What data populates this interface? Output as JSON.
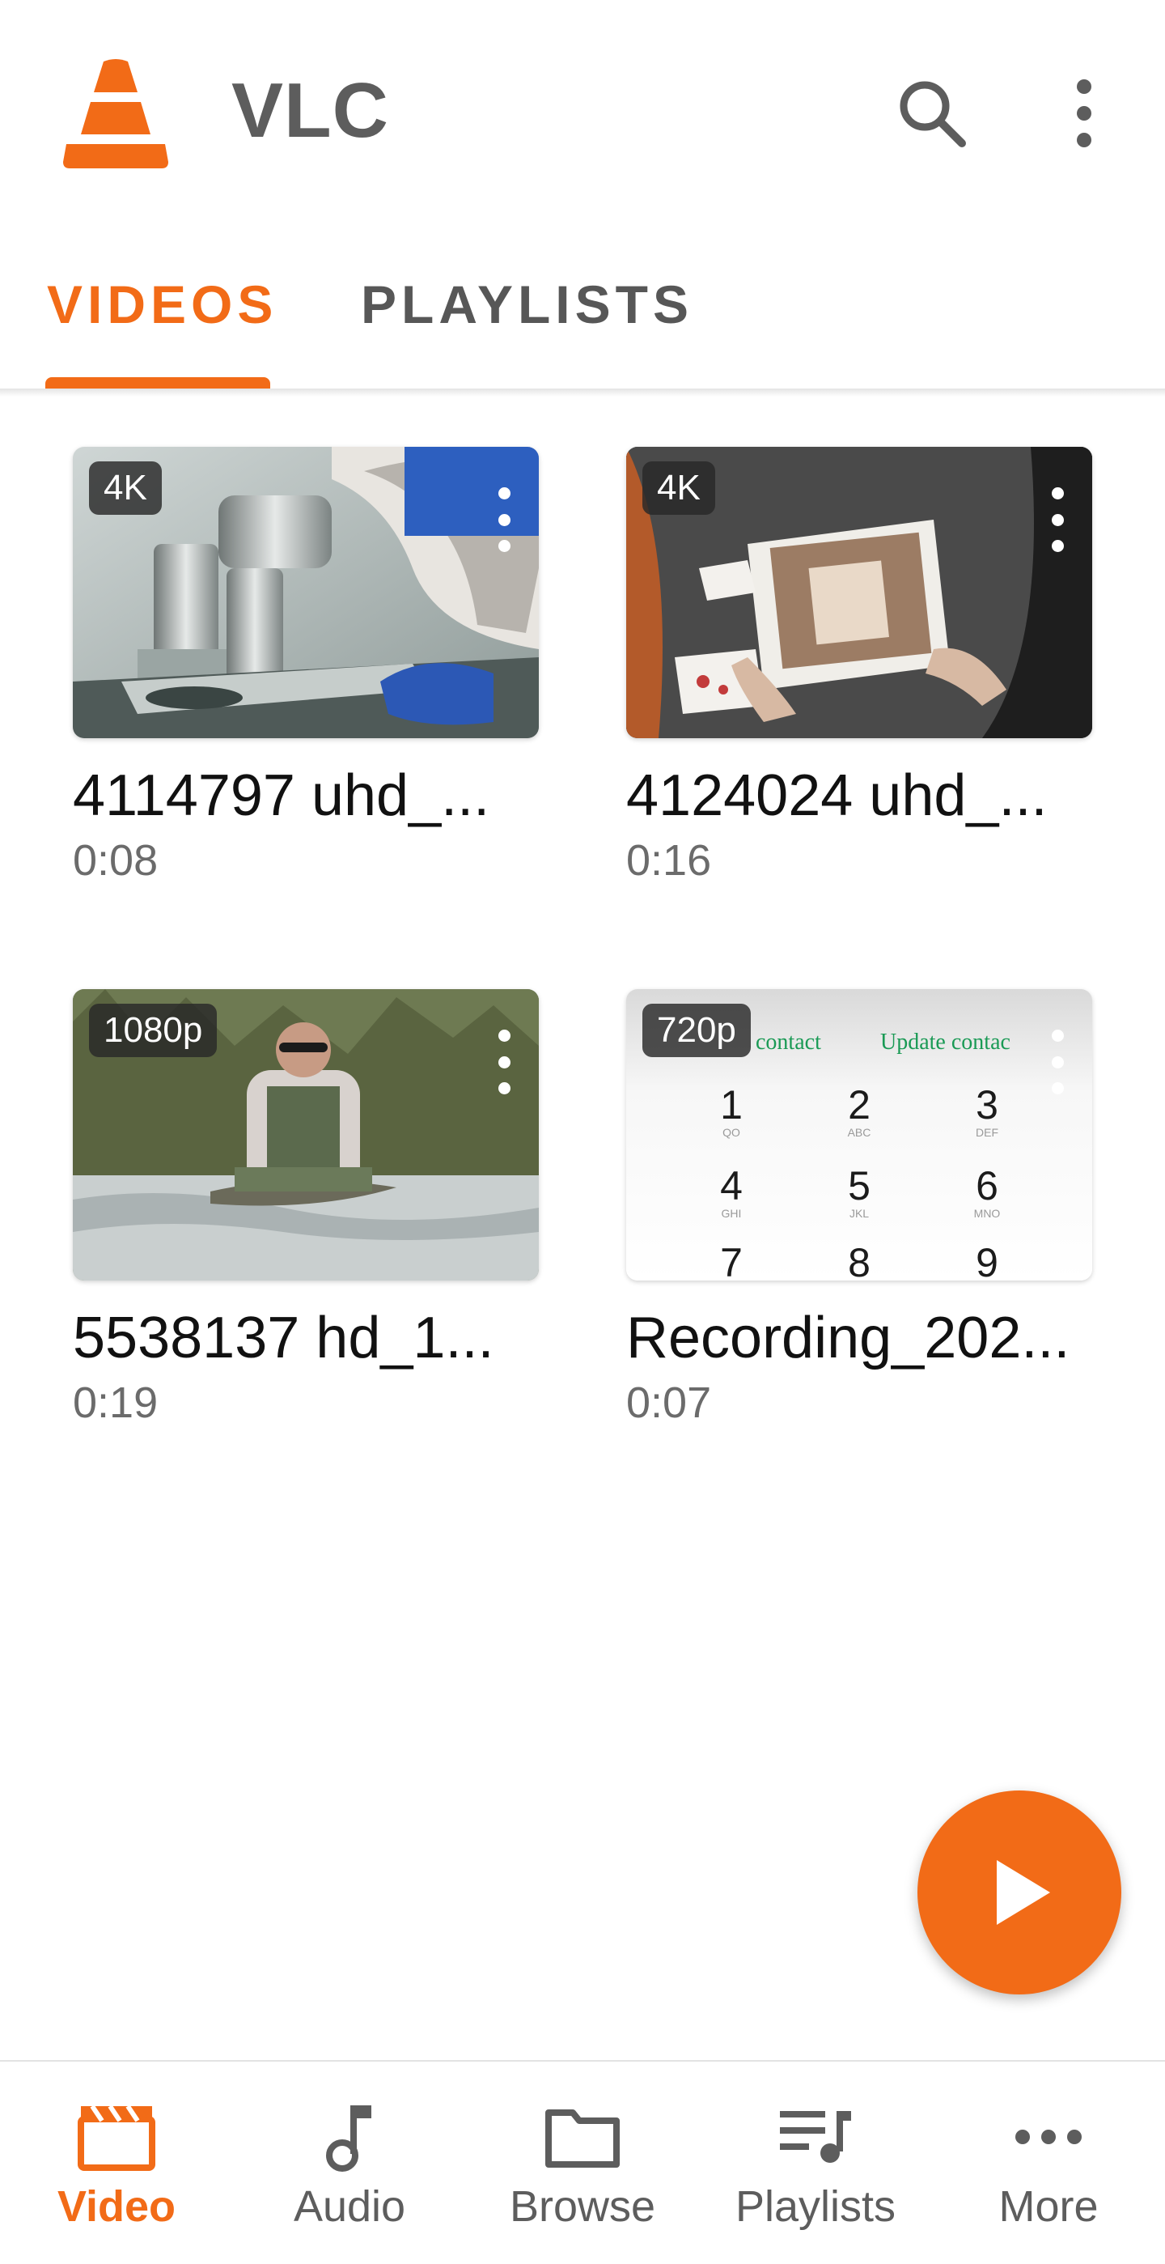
{
  "app": {
    "title": "VLC"
  },
  "tabs": [
    {
      "label": "VIDEOS",
      "active": true
    },
    {
      "label": "PLAYLISTS",
      "active": false
    }
  ],
  "videos": [
    {
      "title": "4114797 uhd_...",
      "duration": "0:08",
      "badge": "4K",
      "thumbnail": "microscope"
    },
    {
      "title": "4124024 uhd_...",
      "duration": "0:16",
      "badge": "4K",
      "thumbnail": "tablet-hands"
    },
    {
      "title": "5538137 hd_1...",
      "duration": "0:19",
      "badge": "1080p",
      "thumbnail": "fisherman-river"
    },
    {
      "title": "Recording_202...",
      "duration": "0:07",
      "badge": "720p",
      "thumbnail": "dialer-screen"
    }
  ],
  "dialer_thumb": {
    "left_text": "contact",
    "right_text": "Update contac",
    "keys": [
      "1",
      "2",
      "3",
      "4",
      "5",
      "6",
      "7",
      "8",
      "9"
    ],
    "subs": [
      "QO",
      "ABC",
      "DEF",
      "GHI",
      "JKL",
      "MNO"
    ]
  },
  "bottom_nav": [
    {
      "label": "Video",
      "icon": "clapperboard-icon",
      "active": true
    },
    {
      "label": "Audio",
      "icon": "music-note-icon",
      "active": false
    },
    {
      "label": "Browse",
      "icon": "folder-icon",
      "active": false
    },
    {
      "label": "Playlists",
      "icon": "playlist-icon",
      "active": false
    },
    {
      "label": "More",
      "icon": "more-horizontal-icon",
      "active": false
    }
  ],
  "colors": {
    "accent": "#f26b17",
    "text": "#111111",
    "secondary_text": "#6b6b6b",
    "icon_gray": "#5d5d5d"
  }
}
